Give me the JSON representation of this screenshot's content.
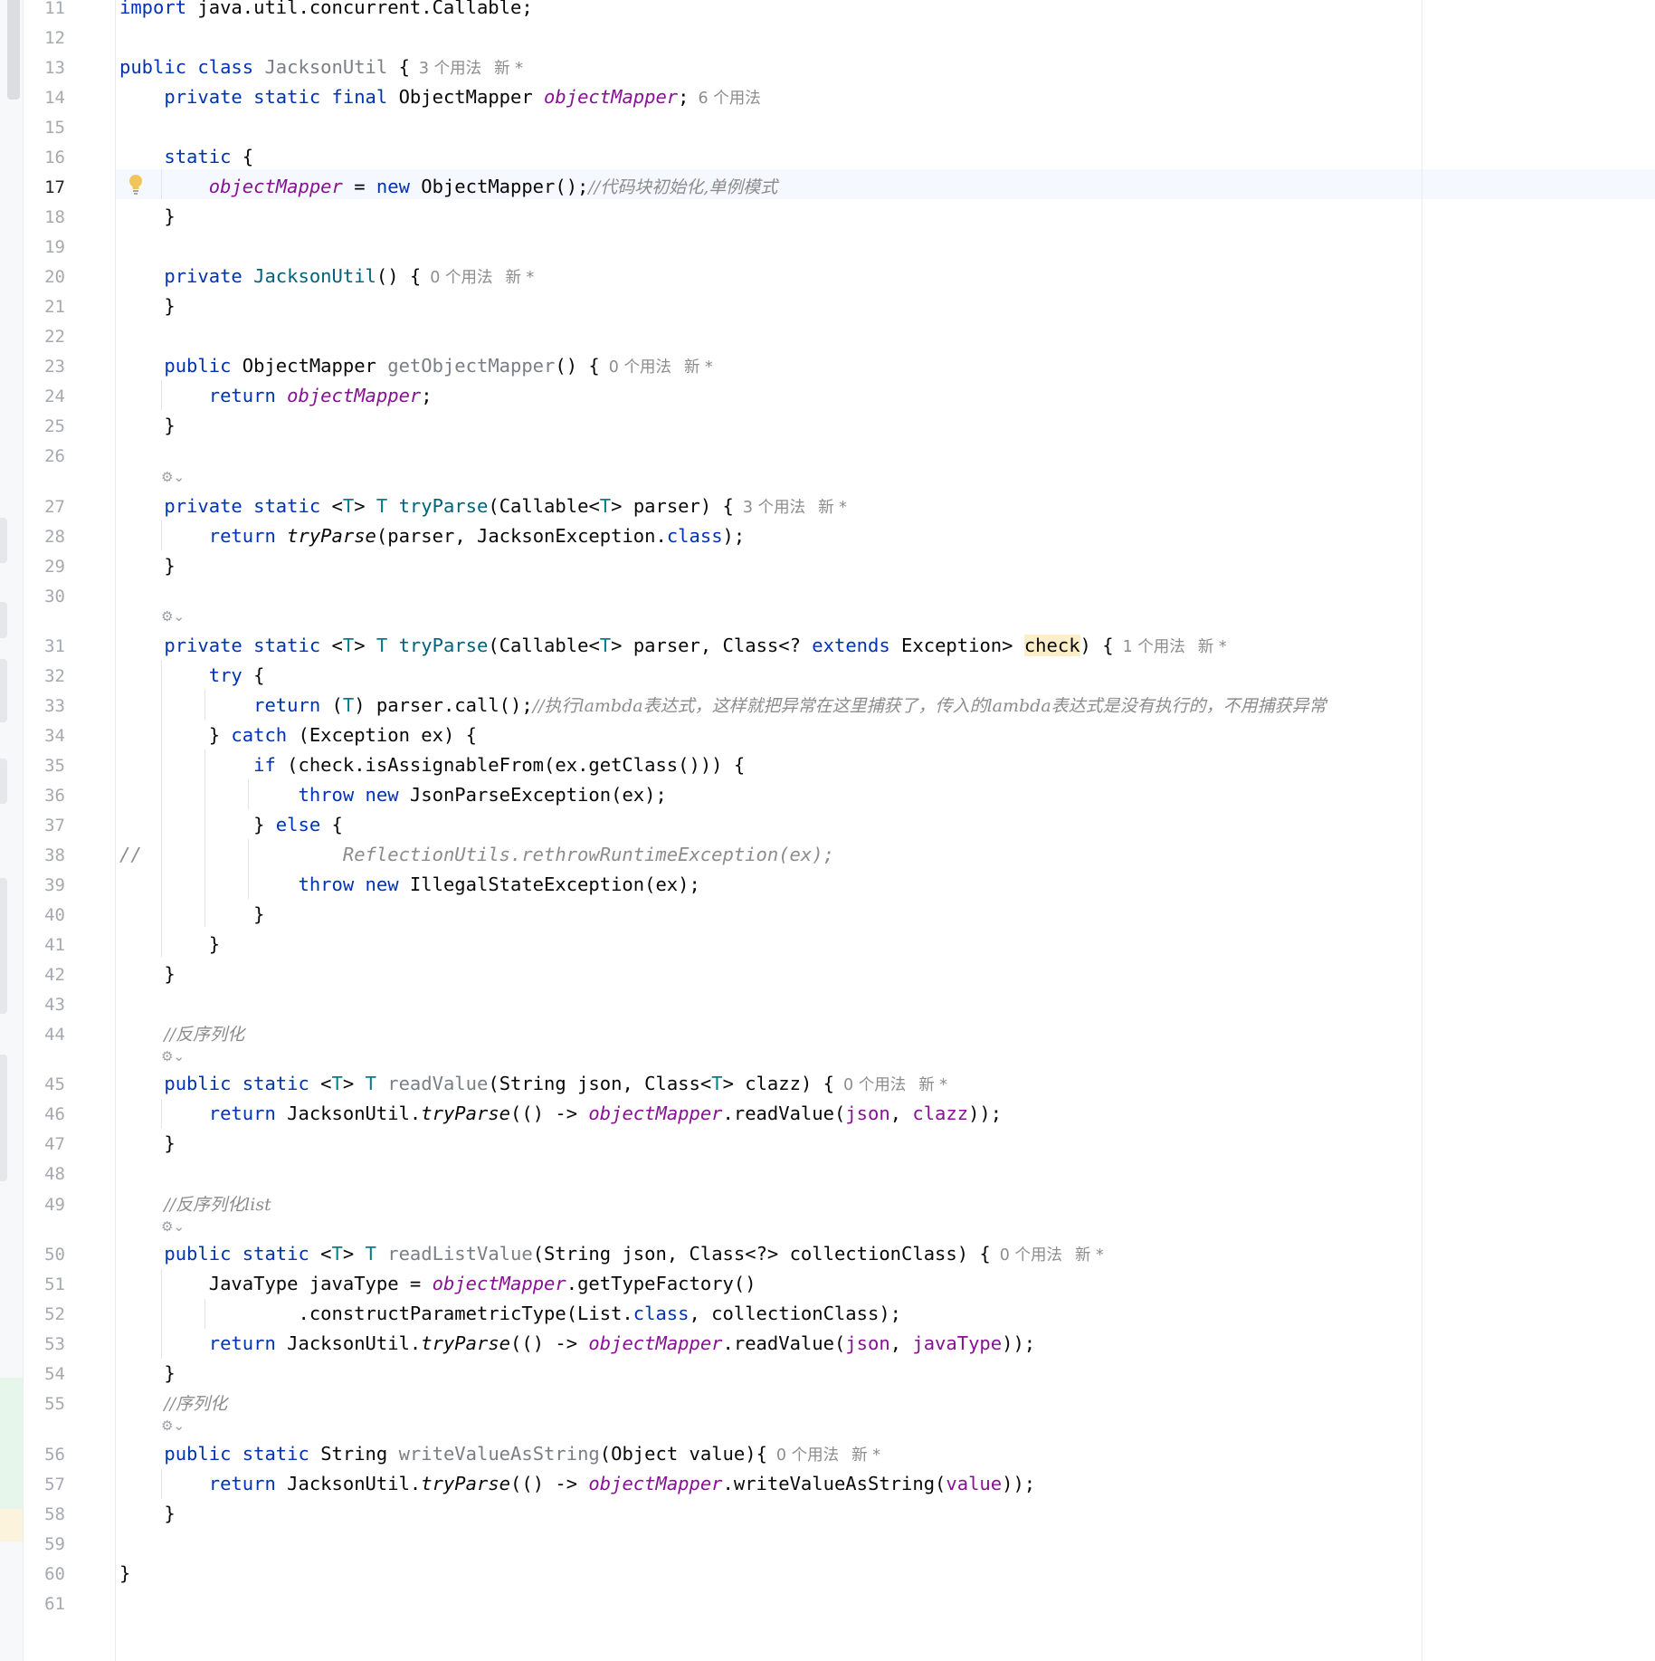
{
  "editor": {
    "current_line": 17,
    "lines": [
      {
        "n": "11"
      },
      {
        "n": "12"
      },
      {
        "n": "13"
      },
      {
        "n": "14"
      },
      {
        "n": "15"
      },
      {
        "n": "16"
      },
      {
        "n": "17"
      },
      {
        "n": "18"
      },
      {
        "n": "19"
      },
      {
        "n": "20"
      },
      {
        "n": "21"
      },
      {
        "n": "22"
      },
      {
        "n": "23"
      },
      {
        "n": "24"
      },
      {
        "n": "25"
      },
      {
        "n": "26"
      },
      {
        "n": "27"
      },
      {
        "n": "28"
      },
      {
        "n": "29"
      },
      {
        "n": "30"
      },
      {
        "n": "31"
      },
      {
        "n": "32"
      },
      {
        "n": "33"
      },
      {
        "n": "34"
      },
      {
        "n": "35"
      },
      {
        "n": "36"
      },
      {
        "n": "37"
      },
      {
        "n": "38"
      },
      {
        "n": "39"
      },
      {
        "n": "40"
      },
      {
        "n": "41"
      },
      {
        "n": "42"
      },
      {
        "n": "43"
      },
      {
        "n": "44"
      },
      {
        "n": "45"
      },
      {
        "n": "46"
      },
      {
        "n": "47"
      },
      {
        "n": "48"
      },
      {
        "n": "49"
      },
      {
        "n": "50"
      },
      {
        "n": "51"
      },
      {
        "n": "52"
      },
      {
        "n": "53"
      },
      {
        "n": "54"
      },
      {
        "n": "55"
      },
      {
        "n": "56"
      },
      {
        "n": "57"
      },
      {
        "n": "58"
      },
      {
        "n": "59"
      },
      {
        "n": "60"
      },
      {
        "n": "61"
      }
    ],
    "tokens": {
      "import_kw": "import",
      "import_path": " java.util.concurrent.Callable;",
      "public": "public",
      "class": "class",
      "private": "private",
      "static": "static",
      "final": "final",
      "new": "new",
      "return": "return",
      "try": "try",
      "catch": "catch",
      "if": "if",
      "throw": "throw",
      "else": "else",
      "extends": "extends",
      "class_lit": "class",
      "JacksonUtil": "JacksonUtil",
      "ObjectMapper": "ObjectMapper",
      "objectMapper": "objectMapper",
      "Callable": "Callable",
      "T": "T",
      "parser": "parser",
      "JacksonException": "JacksonException",
      "Exception": "Exception",
      "check": "check",
      "ex": "ex",
      "JsonParseException": "JsonParseException",
      "IllegalStateException": "IllegalStateException",
      "String": "String",
      "json": "json",
      "clazz": "clazz",
      "collectionClass": "collectionClass",
      "JavaType": "JavaType",
      "javaType": "javaType",
      "List": "List",
      "Object": "Object",
      "value": "value",
      "getObjectMapper": "getObjectMapper",
      "tryParse": "tryParse",
      "readValue": "readValue",
      "readListValue": "readListValue",
      "writeValueAsString": "writeValueAsString",
      "getTypeFactory": "getTypeFactory",
      "constructParametricType": "constructParametricType",
      "call": "call",
      "isAssignableFrom": "isAssignableFrom",
      "getClass": "getClass",
      "comment_17": "//代码块初始化,单例模式",
      "comment_33": "//执行lambda表达式，这样就把异常在这里捕获了，传入的lambda表达式是没有执行的，不用捕获异常",
      "comment_38_slash": "//",
      "comment_38_body": "ReflectionUtils.rethrowRuntimeException(ex);",
      "comment_44": "//反序列化",
      "comment_49": "//反序列化list",
      "comment_55": "//序列化"
    },
    "hints": {
      "h13": "3 个用法",
      "h14": "6 个用法",
      "h20": "0 个用法",
      "h23": "0 个用法",
      "h27": "3 个用法",
      "h31": "1 个用法",
      "h45": "0 个用法",
      "h50": "0 个用法",
      "h56": "0 个用法",
      "new_star": "新 *"
    }
  }
}
